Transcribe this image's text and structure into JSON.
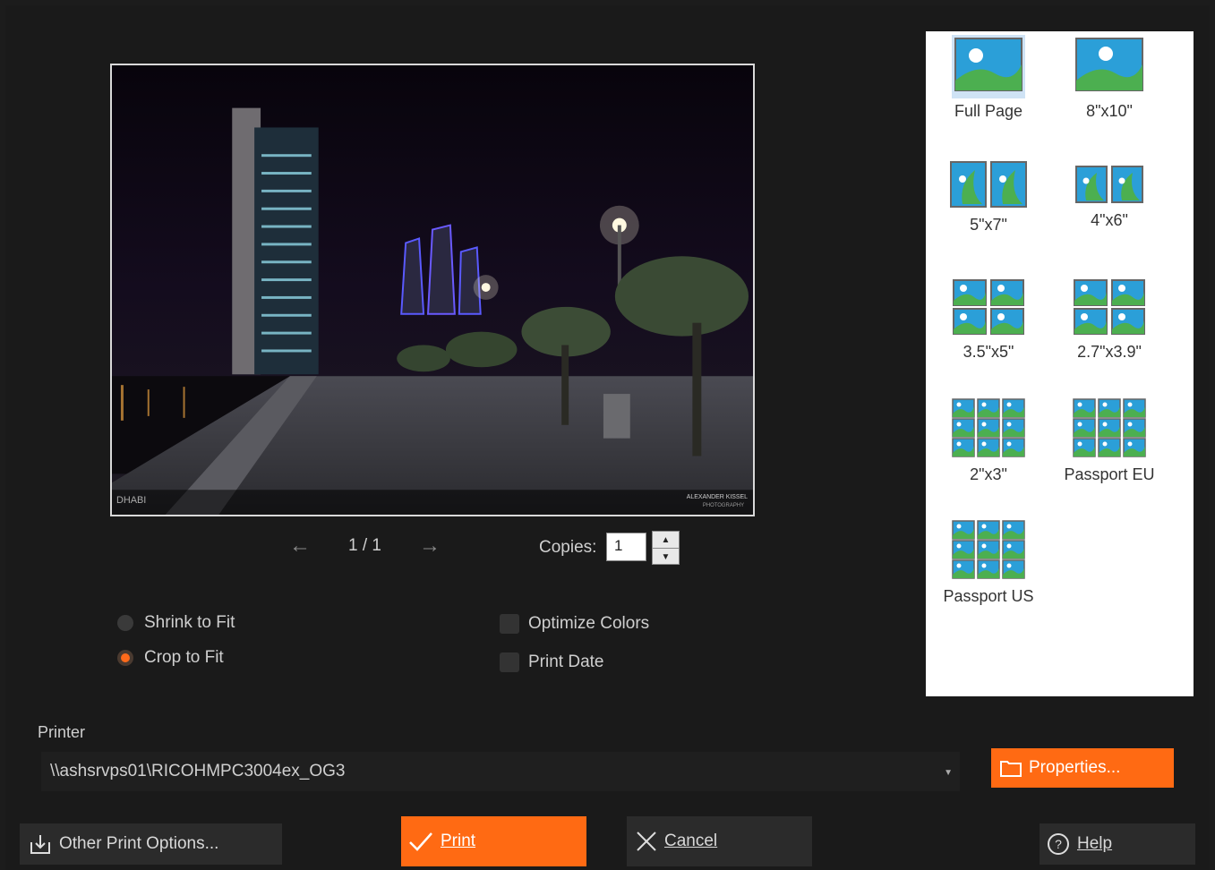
{
  "preview": {
    "watermark_left": "DHABI",
    "watermark_right_1": "ALEXANDER KISSEL",
    "watermark_right_2": "PHOTOGRAPHY"
  },
  "navigation": {
    "page": "1 / 1",
    "prev_icon": "arrow-left-icon",
    "next_icon": "arrow-right-icon"
  },
  "copies": {
    "label": "Copies:",
    "value": "1"
  },
  "fit_options": [
    {
      "label": "Shrink to Fit",
      "selected": false
    },
    {
      "label": "Crop to Fit",
      "selected": true
    }
  ],
  "check_options": [
    {
      "label": "Optimize Colors",
      "checked": false
    },
    {
      "label": "Print Date",
      "checked": false
    }
  ],
  "sizes": [
    "Full Page",
    "8\"x10\"",
    "5\"x7\"",
    "4\"x6\"",
    "3.5\"x5\"",
    "2.7\"x3.9\"",
    "2\"x3\"",
    "Passport EU",
    "Passport US"
  ],
  "printer": {
    "label": "Printer",
    "value": "\\\\ashsrvps01\\RICOHMPC3004ex_OG3"
  },
  "buttons": {
    "properties": "Properties...",
    "other": "Other Print Options...",
    "print": "Print",
    "cancel": "Cancel",
    "help": "Help"
  },
  "colors": {
    "accent": "#ff6a13",
    "background": "#1a1a1a",
    "panel": "#ffffff"
  }
}
